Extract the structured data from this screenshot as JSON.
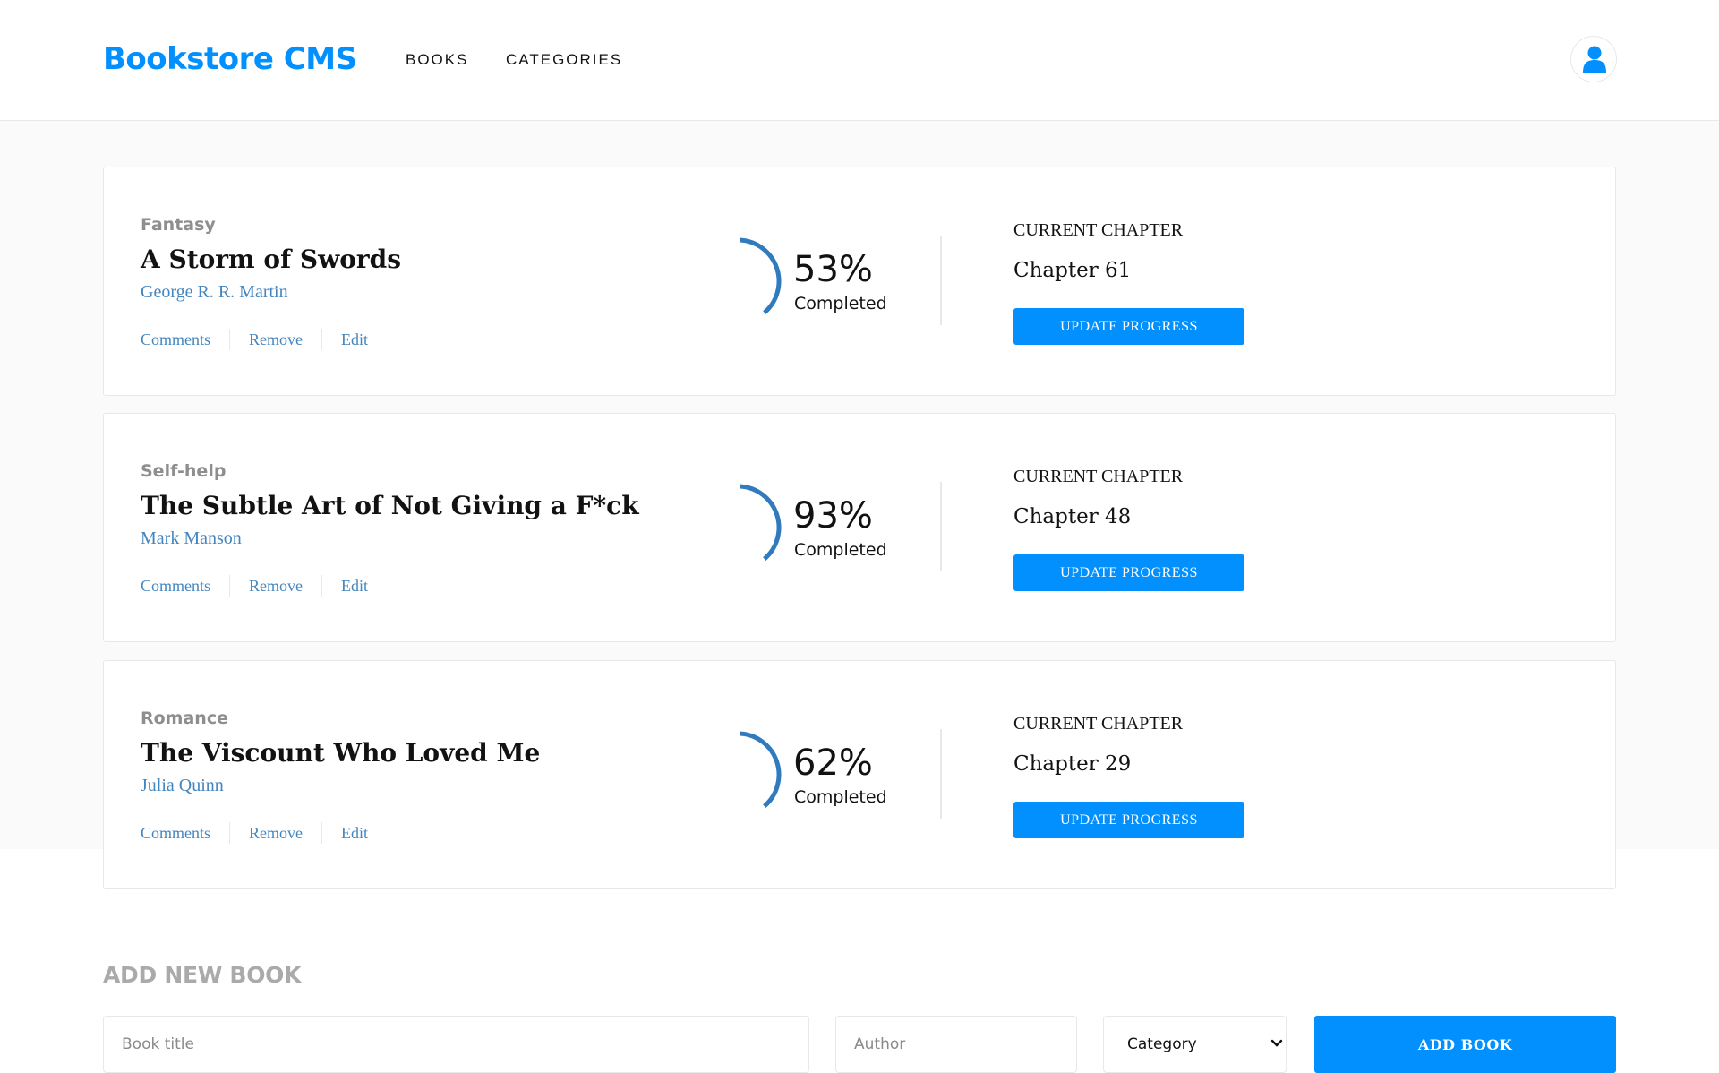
{
  "header": {
    "logo": "Bookstore CMS",
    "nav": [
      {
        "label": "BOOKS"
      },
      {
        "label": "CATEGORIES"
      }
    ],
    "avatar_icon": "user-icon"
  },
  "books": [
    {
      "category": "Fantasy",
      "title": "A Storm of Swords",
      "author": "George R. R. Martin",
      "actions": [
        "Comments",
        "Remove",
        "Edit"
      ],
      "percent": "53%",
      "progress": 0.53,
      "completed_label": "Completed",
      "chapter_label": "CURRENT CHAPTER",
      "chapter": "Chapter 61",
      "update_label": "UPDATE PROGRESS"
    },
    {
      "category": "Self-help",
      "title": "The Subtle Art of Not Giving a F*ck",
      "author": "Mark Manson",
      "actions": [
        "Comments",
        "Remove",
        "Edit"
      ],
      "percent": "93%",
      "progress": 0.93,
      "completed_label": "Completed",
      "chapter_label": "CURRENT CHAPTER",
      "chapter": "Chapter 48",
      "update_label": "UPDATE PROGRESS"
    },
    {
      "category": "Romance",
      "title": "The Viscount Who Loved Me",
      "author": "Julia Quinn",
      "actions": [
        "Comments",
        "Remove",
        "Edit"
      ],
      "percent": "62%",
      "progress": 0.62,
      "completed_label": "Completed",
      "chapter_label": "CURRENT CHAPTER",
      "chapter": "Chapter 29",
      "update_label": "UPDATE PROGRESS"
    }
  ],
  "add_form": {
    "title": "ADD NEW BOOK",
    "book_title_placeholder": "Book title",
    "author_placeholder": "Author",
    "category_selected": "Category",
    "submit_label": "ADD BOOK"
  },
  "colors": {
    "accent": "#0290ff",
    "progress_ring": "#307bbe",
    "author_link": "#4386bf"
  }
}
